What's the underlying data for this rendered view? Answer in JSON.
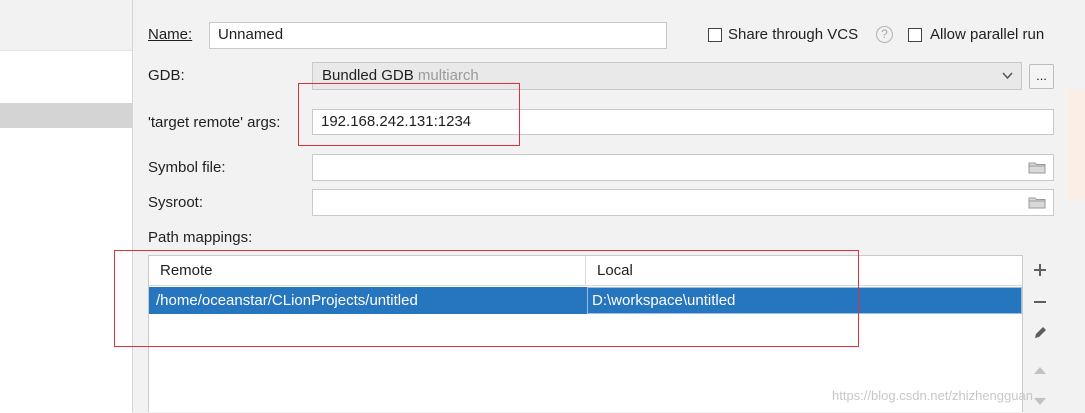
{
  "name_field": {
    "label": "Name:",
    "value": "Unnamed"
  },
  "share_vcs": {
    "label": "Share through VCS",
    "checked": false,
    "help_icon": "question-circle-icon"
  },
  "parallel_run": {
    "label": "Allow parallel run",
    "checked": false
  },
  "gdb": {
    "label": "GDB:",
    "value": "Bundled GDB",
    "hint": "multiarch",
    "browse_label": "..."
  },
  "target_remote": {
    "label": "'target remote' args:",
    "value": "192.168.242.131:1234"
  },
  "symbol_file": {
    "label": "Symbol file:",
    "value": "",
    "icon": "folder-icon"
  },
  "sysroot": {
    "label": "Sysroot:",
    "value": "",
    "icon": "folder-icon"
  },
  "path_mappings": {
    "label": "Path mappings:",
    "columns": [
      "Remote",
      "Local"
    ],
    "rows": [
      {
        "remote": "/home/oceanstar/CLionProjects/untitled",
        "local": "D:\\workspace\\untitled",
        "selected": true
      }
    ],
    "toolbar": [
      "add-icon",
      "remove-icon",
      "edit-icon",
      "move-up-icon",
      "move-down-icon"
    ]
  },
  "watermark": "https://blog.csdn.net/zhizhengguan",
  "colors": {
    "selection": "#2675bf",
    "highlight_box": "#e0303e",
    "field_border": "#c9c9c9"
  }
}
